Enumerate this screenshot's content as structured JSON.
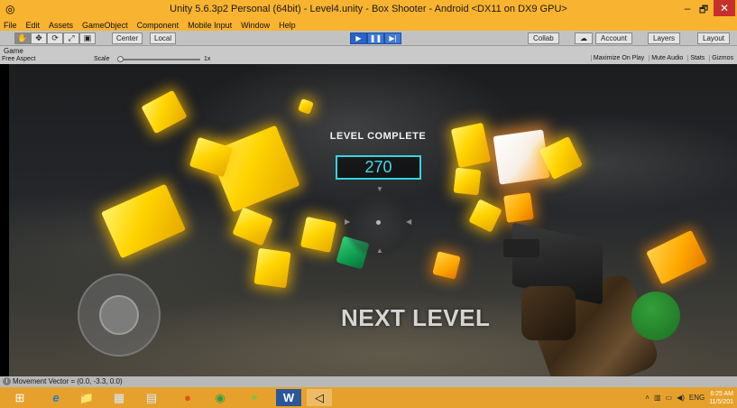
{
  "window": {
    "title": "Unity 5.6.3p2 Personal (64bit) - Level4.unity - Box Shooter - Android <DX11 on DX9 GPU>",
    "min_label": "–",
    "max_label": "🗗",
    "close_label": "✕"
  },
  "menu": {
    "items": [
      "File",
      "Edit",
      "Assets",
      "GameObject",
      "Component",
      "Mobile Input",
      "Window",
      "Help"
    ]
  },
  "toolbar": {
    "tools": [
      "✋",
      "✥",
      "⟳",
      "⤢",
      "▣"
    ],
    "pivot_label": "Center",
    "space_label": "Local",
    "play_buttons": [
      "▶",
      "❚❚",
      "▶|"
    ],
    "collab_label": "Collab",
    "cloud_icon": "☁",
    "account_label": "Account",
    "layers_label": "Layers",
    "layout_label": "Layout"
  },
  "game_view": {
    "tab_label": "Game",
    "aspect_label": "Free Aspect",
    "scale_label": "Scale",
    "scale_value": "1x",
    "options": [
      "Maximize On Play",
      "Mute Audio",
      "Stats",
      "Gizmos"
    ]
  },
  "game": {
    "level_complete": "LEVEL COMPLETE",
    "score": "270",
    "next_level": "NEXT LEVEL",
    "colors": {
      "score_accent": "#3fdbe8",
      "cube_yellow": "#ffd400",
      "cube_green": "#0f9a4e",
      "fire_button": "#1c6e22"
    }
  },
  "status": {
    "message": "Movement Vector = (0.0, -3.3, 0.0)"
  },
  "taskbar": {
    "items": [
      {
        "name": "windows-start-icon",
        "glyph": "⊞"
      },
      {
        "name": "internet-explorer-icon",
        "glyph": "e"
      },
      {
        "name": "file-explorer-icon",
        "glyph": "📁"
      },
      {
        "name": "media-player-icon",
        "glyph": "▦"
      },
      {
        "name": "store-icon",
        "glyph": "▤"
      },
      {
        "name": "firefox-icon",
        "glyph": "●"
      },
      {
        "name": "chrome-icon",
        "glyph": "◉"
      },
      {
        "name": "android-icon",
        "glyph": "✦"
      },
      {
        "name": "word-icon",
        "glyph": "W"
      },
      {
        "name": "unity-icon",
        "glyph": "◁"
      }
    ],
    "tray": {
      "language": "ENG",
      "time": "6:25 AM",
      "date": "11/5/201"
    }
  }
}
